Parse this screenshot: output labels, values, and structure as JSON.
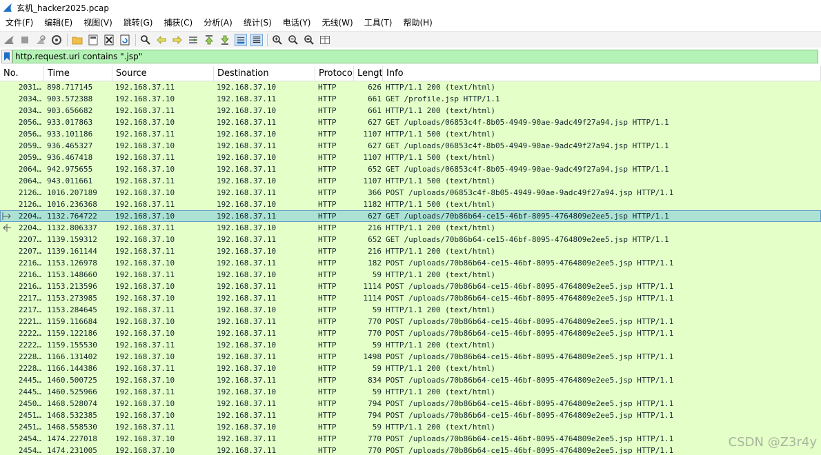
{
  "window": {
    "title": "玄机_hacker2025.pcap"
  },
  "menu": [
    "文件(F)",
    "编辑(E)",
    "视图(V)",
    "跳转(G)",
    "捕获(C)",
    "分析(A)",
    "统计(S)",
    "电话(Y)",
    "无线(W)",
    "工具(T)",
    "帮助(H)"
  ],
  "toolbar": {
    "icons": [
      "shark-fin-start-icon",
      "stop-square-icon",
      "restart-icon",
      "capture-options-gear-icon",
      "open-folder-icon",
      "save-file-icon",
      "close-file-icon",
      "reload-icon",
      "find-magnifier-icon",
      "go-back-arrow-icon",
      "go-forward-arrow-icon",
      "go-to-packet-icon",
      "first-packet-icon",
      "last-packet-icon",
      "autoscroll-icon",
      "colorize-icon",
      "zoom-in-icon",
      "zoom-out-icon",
      "zoom-reset-icon",
      "resize-columns-icon"
    ]
  },
  "filter": {
    "value": "http.request.uri contains \".jsp\""
  },
  "columns": {
    "no": "No.",
    "time": "Time",
    "source": "Source",
    "destination": "Destination",
    "protocol": "Protoco",
    "length": "Lengt",
    "info": "Info"
  },
  "packets": [
    {
      "no": "2031…",
      "time": "898.717145",
      "src": "192.168.37.11",
      "dst": "192.168.37.10",
      "proto": "HTTP",
      "len": "626",
      "info": "HTTP/1.1 200   (text/html)"
    },
    {
      "no": "2034…",
      "time": "903.572388",
      "src": "192.168.37.10",
      "dst": "192.168.37.11",
      "proto": "HTTP",
      "len": "661",
      "info": "GET /profile.jsp HTTP/1.1"
    },
    {
      "no": "2034…",
      "time": "903.656682",
      "src": "192.168.37.11",
      "dst": "192.168.37.10",
      "proto": "HTTP",
      "len": "661",
      "info": "HTTP/1.1 200   (text/html)"
    },
    {
      "no": "2056…",
      "time": "933.017863",
      "src": "192.168.37.10",
      "dst": "192.168.37.11",
      "proto": "HTTP",
      "len": "627",
      "info": "GET /uploads/06853c4f-8b05-4949-90ae-9adc49f27a94.jsp HTTP/1.1"
    },
    {
      "no": "2056…",
      "time": "933.101186",
      "src": "192.168.37.11",
      "dst": "192.168.37.10",
      "proto": "HTTP",
      "len": "1107",
      "info": "HTTP/1.1 500   (text/html)"
    },
    {
      "no": "2059…",
      "time": "936.465327",
      "src": "192.168.37.10",
      "dst": "192.168.37.11",
      "proto": "HTTP",
      "len": "627",
      "info": "GET /uploads/06853c4f-8b05-4949-90ae-9adc49f27a94.jsp HTTP/1.1"
    },
    {
      "no": "2059…",
      "time": "936.467418",
      "src": "192.168.37.11",
      "dst": "192.168.37.10",
      "proto": "HTTP",
      "len": "1107",
      "info": "HTTP/1.1 500   (text/html)"
    },
    {
      "no": "2064…",
      "time": "942.975655",
      "src": "192.168.37.10",
      "dst": "192.168.37.11",
      "proto": "HTTP",
      "len": "652",
      "info": "GET /uploads/06853c4f-8b05-4949-90ae-9adc49f27a94.jsp HTTP/1.1"
    },
    {
      "no": "2064…",
      "time": "943.011661",
      "src": "192.168.37.11",
      "dst": "192.168.37.10",
      "proto": "HTTP",
      "len": "1107",
      "info": "HTTP/1.1 500   (text/html)"
    },
    {
      "no": "2126…",
      "time": "1016.207189",
      "src": "192.168.37.10",
      "dst": "192.168.37.11",
      "proto": "HTTP",
      "len": "366",
      "info": "POST /uploads/06853c4f-8b05-4949-90ae-9adc49f27a94.jsp HTTP/1.1"
    },
    {
      "no": "2126…",
      "time": "1016.236368",
      "src": "192.168.37.11",
      "dst": "192.168.37.10",
      "proto": "HTTP",
      "len": "1182",
      "info": "HTTP/1.1 500   (text/html)"
    },
    {
      "no": "2204…",
      "time": "1132.764722",
      "src": "192.168.37.10",
      "dst": "192.168.37.11",
      "proto": "HTTP",
      "len": "627",
      "info": "GET /uploads/70b86b64-ce15-46bf-8095-4764809e2ee5.jsp HTTP/1.1",
      "selected": true,
      "mark": "request"
    },
    {
      "no": "2204…",
      "time": "1132.806337",
      "src": "192.168.37.11",
      "dst": "192.168.37.10",
      "proto": "HTTP",
      "len": "216",
      "info": "HTTP/1.1 200   (text/html)",
      "mark": "response"
    },
    {
      "no": "2207…",
      "time": "1139.159312",
      "src": "192.168.37.10",
      "dst": "192.168.37.11",
      "proto": "HTTP",
      "len": "652",
      "info": "GET /uploads/70b86b64-ce15-46bf-8095-4764809e2ee5.jsp HTTP/1.1"
    },
    {
      "no": "2207…",
      "time": "1139.161144",
      "src": "192.168.37.11",
      "dst": "192.168.37.10",
      "proto": "HTTP",
      "len": "216",
      "info": "HTTP/1.1 200   (text/html)"
    },
    {
      "no": "2216…",
      "time": "1153.126978",
      "src": "192.168.37.10",
      "dst": "192.168.37.11",
      "proto": "HTTP",
      "len": "182",
      "info": "POST /uploads/70b86b64-ce15-46bf-8095-4764809e2ee5.jsp HTTP/1.1"
    },
    {
      "no": "2216…",
      "time": "1153.148660",
      "src": "192.168.37.11",
      "dst": "192.168.37.10",
      "proto": "HTTP",
      "len": "59",
      "info": "HTTP/1.1 200   (text/html)"
    },
    {
      "no": "2216…",
      "time": "1153.213596",
      "src": "192.168.37.10",
      "dst": "192.168.37.11",
      "proto": "HTTP",
      "len": "1114",
      "info": "POST /uploads/70b86b64-ce15-46bf-8095-4764809e2ee5.jsp HTTP/1.1"
    },
    {
      "no": "2217…",
      "time": "1153.273985",
      "src": "192.168.37.10",
      "dst": "192.168.37.11",
      "proto": "HTTP",
      "len": "1114",
      "info": "POST /uploads/70b86b64-ce15-46bf-8095-4764809e2ee5.jsp HTTP/1.1"
    },
    {
      "no": "2217…",
      "time": "1153.284645",
      "src": "192.168.37.11",
      "dst": "192.168.37.10",
      "proto": "HTTP",
      "len": "59",
      "info": "HTTP/1.1 200   (text/html)"
    },
    {
      "no": "2221…",
      "time": "1159.116684",
      "src": "192.168.37.10",
      "dst": "192.168.37.11",
      "proto": "HTTP",
      "len": "770",
      "info": "POST /uploads/70b86b64-ce15-46bf-8095-4764809e2ee5.jsp HTTP/1.1"
    },
    {
      "no": "2222…",
      "time": "1159.122186",
      "src": "192.168.37.10",
      "dst": "192.168.37.11",
      "proto": "HTTP",
      "len": "770",
      "info": "POST /uploads/70b86b64-ce15-46bf-8095-4764809e2ee5.jsp HTTP/1.1"
    },
    {
      "no": "2222…",
      "time": "1159.155530",
      "src": "192.168.37.11",
      "dst": "192.168.37.10",
      "proto": "HTTP",
      "len": "59",
      "info": "HTTP/1.1 200   (text/html)"
    },
    {
      "no": "2228…",
      "time": "1166.131402",
      "src": "192.168.37.10",
      "dst": "192.168.37.11",
      "proto": "HTTP",
      "len": "1498",
      "info": "POST /uploads/70b86b64-ce15-46bf-8095-4764809e2ee5.jsp HTTP/1.1"
    },
    {
      "no": "2228…",
      "time": "1166.144386",
      "src": "192.168.37.11",
      "dst": "192.168.37.10",
      "proto": "HTTP",
      "len": "59",
      "info": "HTTP/1.1 200   (text/html)"
    },
    {
      "no": "2445…",
      "time": "1460.500725",
      "src": "192.168.37.10",
      "dst": "192.168.37.11",
      "proto": "HTTP",
      "len": "834",
      "info": "POST /uploads/70b86b64-ce15-46bf-8095-4764809e2ee5.jsp HTTP/1.1"
    },
    {
      "no": "2445…",
      "time": "1460.525966",
      "src": "192.168.37.11",
      "dst": "192.168.37.10",
      "proto": "HTTP",
      "len": "59",
      "info": "HTTP/1.1 200   (text/html)"
    },
    {
      "no": "2450…",
      "time": "1468.528074",
      "src": "192.168.37.10",
      "dst": "192.168.37.11",
      "proto": "HTTP",
      "len": "794",
      "info": "POST /uploads/70b86b64-ce15-46bf-8095-4764809e2ee5.jsp HTTP/1.1"
    },
    {
      "no": "2451…",
      "time": "1468.532385",
      "src": "192.168.37.10",
      "dst": "192.168.37.11",
      "proto": "HTTP",
      "len": "794",
      "info": "POST /uploads/70b86b64-ce15-46bf-8095-4764809e2ee5.jsp HTTP/1.1"
    },
    {
      "no": "2451…",
      "time": "1468.558530",
      "src": "192.168.37.11",
      "dst": "192.168.37.10",
      "proto": "HTTP",
      "len": "59",
      "info": "HTTP/1.1 200   (text/html)"
    },
    {
      "no": "2454…",
      "time": "1474.227018",
      "src": "192.168.37.10",
      "dst": "192.168.37.11",
      "proto": "HTTP",
      "len": "770",
      "info": "POST /uploads/70b86b64-ce15-46bf-8095-4764809e2ee5.jsp HTTP/1.1"
    },
    {
      "no": "2454…",
      "time": "1474.231005",
      "src": "192.168.37.10",
      "dst": "192.168.37.11",
      "proto": "HTTP",
      "len": "770",
      "info": "POST /uploads/70b86b64-ce15-46bf-8095-4764809e2ee5.jsp HTTP/1.1"
    }
  ],
  "watermark": "CSDN @Z3r4y",
  "colors": {
    "row_bg": "#e4ffc7",
    "selected_bg": "#abe2d3",
    "filter_bg": "#b5f2b5"
  }
}
